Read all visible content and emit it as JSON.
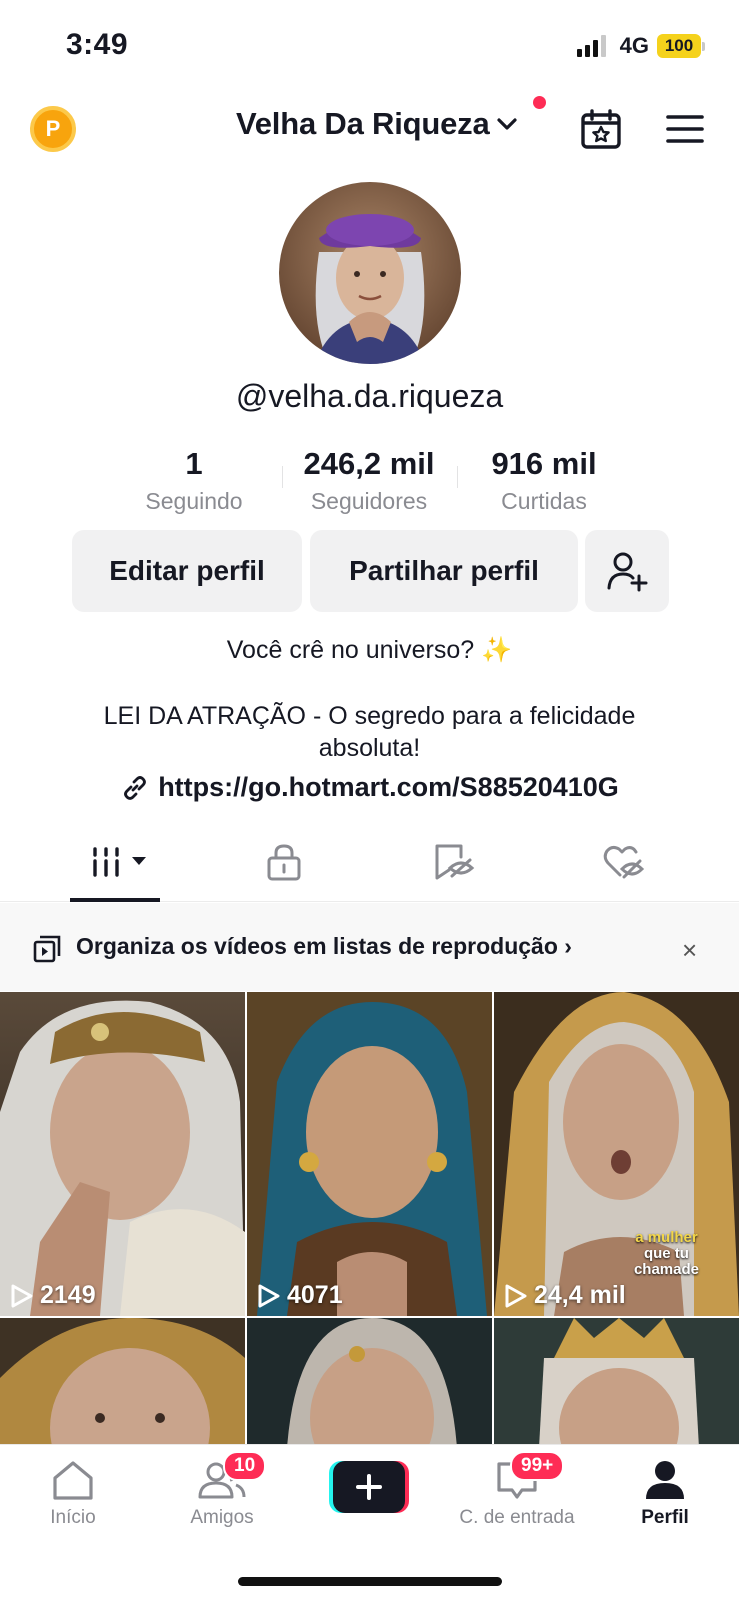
{
  "status_bar": {
    "time": "3:49",
    "network": "4G",
    "battery": "100"
  },
  "header": {
    "account_name": "Velha Da Riqueza",
    "coin_letter": "P"
  },
  "profile": {
    "username": "@velha.da.riqueza",
    "stats": [
      {
        "value": "1",
        "label": "Seguindo"
      },
      {
        "value": "246,2 mil",
        "label": "Seguidores"
      },
      {
        "value": "916 mil",
        "label": "Curtidas"
      }
    ],
    "buttons": {
      "edit": "Editar perfil",
      "share": "Partilhar perfil"
    },
    "bio_line1": "Você crê no universo? ✨",
    "bio_line2": "LEI DA ATRAÇÃO - O segredo para a felicidade",
    "bio_line3": "absoluta!",
    "link": "https://go.hotmart.com/S88520410G"
  },
  "banner": {
    "text": "Organiza os vídeos em listas de reprodução ›",
    "close": "×"
  },
  "videos": [
    {
      "views": "2149"
    },
    {
      "views": "4071"
    },
    {
      "views": "24,4 mil",
      "caption_line1": "a mulher",
      "caption_line2": "que tu",
      "caption_line3": "chamade"
    }
  ],
  "nav": {
    "home": "Início",
    "friends": "Amigos",
    "friends_badge": "10",
    "inbox": "C. de entrada",
    "inbox_badge": "99+",
    "profile": "Perfil"
  },
  "colors": {
    "accent": "#fe2c55",
    "cyan": "#25f4ee",
    "battery": "#f5d21c",
    "coin": "#f8a40d"
  }
}
